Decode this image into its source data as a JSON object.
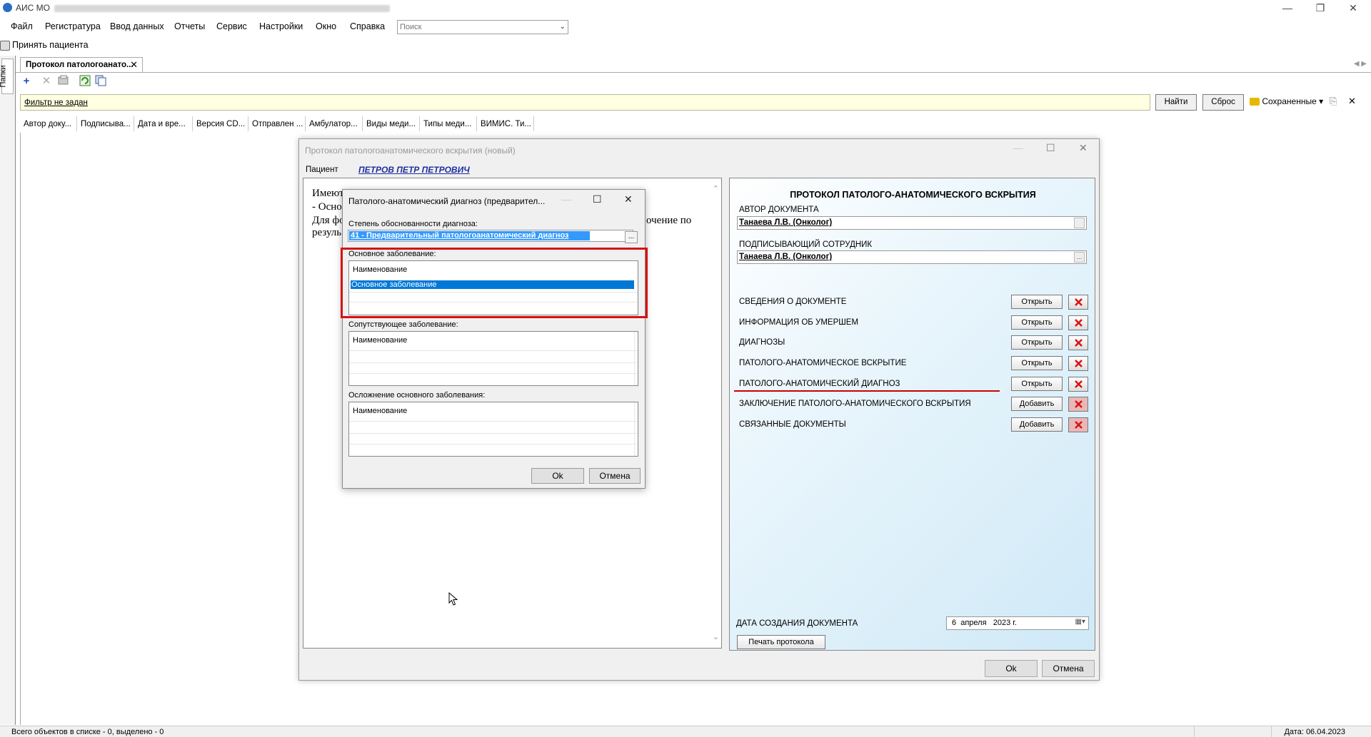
{
  "window": {
    "title": "АИС МО"
  },
  "menu": {
    "items": [
      "Файл",
      "Регистратура",
      "Ввод данных",
      "Отчеты",
      "Сервис",
      "Настройки",
      "Окно",
      "Справка"
    ],
    "search_placeholder": "Поиск"
  },
  "accept_patient": "Принять пациента",
  "folders_label": "Папки",
  "doc_tab": {
    "label": "Протокол патологоанато..."
  },
  "filter": {
    "text": "Фильтр не задан",
    "find": "Найти",
    "reset": "Сброс",
    "saved": "Сохраненные"
  },
  "columns": [
    "Автор доку...",
    "Подписыва...",
    "Дата и вре...",
    "Версия CD...",
    "Отправлен ...",
    "Амбулатор...",
    "Виды меди...",
    "Типы меди...",
    "ВИМИС. Ти..."
  ],
  "status": {
    "left": "Всего объектов в списке - 0, выделено - 0",
    "right": "Дата: 06.04.2023"
  },
  "protocol_dialog": {
    "title": "Протокол патологоанатомического вскрытия (новый)",
    "patient_label": "Пациент",
    "patient_name": "ПЕТРОВ ПЕТР ПЕТРОВИЧ",
    "left_text": [
      "Имеют",
      "- Осно",
      "Для фо",
      "резуль"
    ],
    "left_text_right": "очение по",
    "header": "ПРОТОКОЛ ПАТОЛОГО-АНАТОМИЧЕСКОГО ВСКРЫТИЯ",
    "author_label": "АВТОР ДОКУМЕНТА",
    "author_value": "Танаева Л.В. (Онколог)",
    "signer_label": "ПОДПИСЫВАЮЩИЙ СОТРУДНИК",
    "signer_value": "Танаева Л.В. (Онколог)",
    "sections": [
      {
        "label": "СВЕДЕНИЯ О ДОКУМЕНТЕ",
        "action": "Открыть"
      },
      {
        "label": "ИНФОРМАЦИЯ ОБ УМЕРШЕМ",
        "action": "Открыть"
      },
      {
        "label": "ДИАГНОЗЫ",
        "action": "Открыть"
      },
      {
        "label": "ПАТОЛОГО-АНАТОМИЧЕСКОЕ ВСКРЫТИЕ",
        "action": "Открыть"
      },
      {
        "label": "ПАТОЛОГО-АНАТОМИЧЕСКИЙ ДИАГНОЗ",
        "action": "Открыть"
      },
      {
        "label": "ЗАКЛЮЧЕНИЕ ПАТОЛОГО-АНАТОМИЧЕСКОГО ВСКРЫТИЯ",
        "action": "Добавить"
      },
      {
        "label": "СВЯЗАННЫЕ ДОКУМЕНТЫ",
        "action": "Добавить"
      }
    ],
    "date_label": "ДАТА СОЗДАНИЯ ДОКУМЕНТА",
    "date_value": "6  апреля   2023 г.",
    "print": "Печать протокола",
    "ok": "Ok",
    "cancel": "Отмена"
  },
  "diagnosis_dialog": {
    "title": "Патолого-анатомический диагноз (предварител...",
    "degree_label": "Степень обоснованности диагноза:",
    "degree_value": "41 - Предварительный патологоанатомический диагноз",
    "main_label": "Основное заболевание:",
    "main_header": "Наименование",
    "main_row": "Основное заболевание",
    "concomitant_label": "Сопутствующее заболевание:",
    "concomitant_header": "Наименование",
    "complication_label": "Осложнение основного заболевания:",
    "complication_header": "Наименование",
    "ok": "Ok",
    "cancel": "Отмена"
  }
}
